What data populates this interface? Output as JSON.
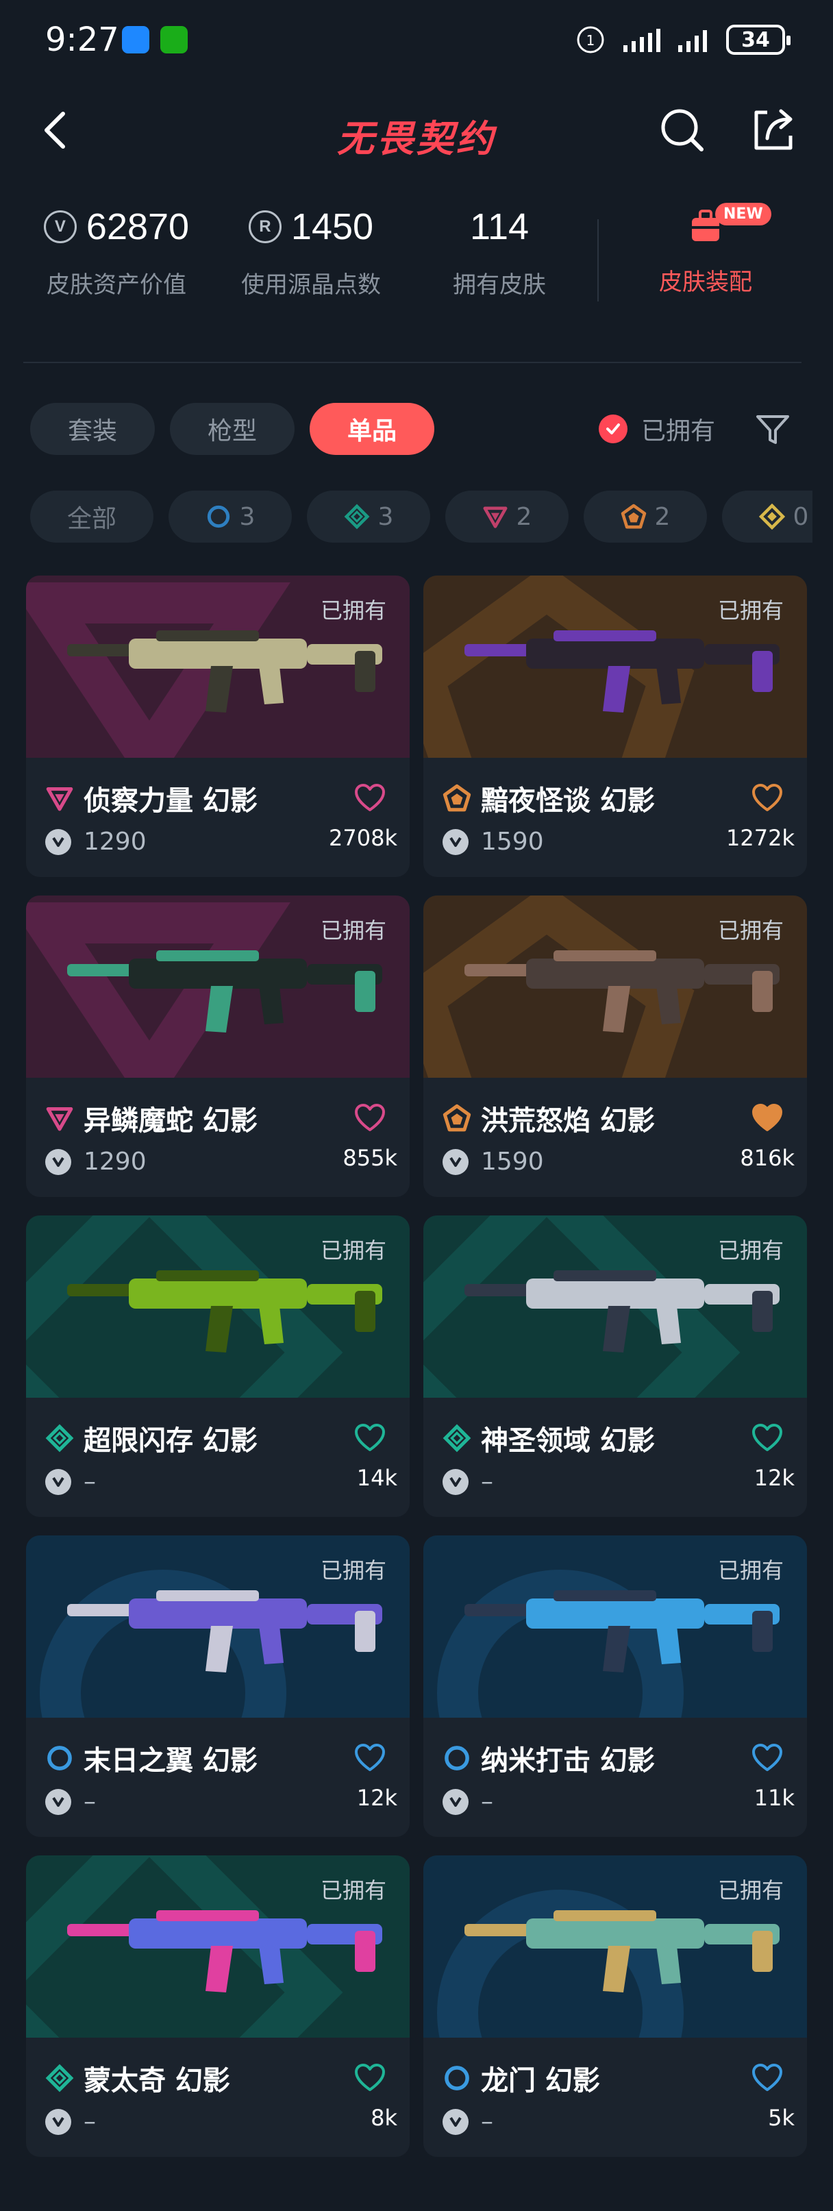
{
  "status_bar": {
    "time": "9:27",
    "network_label": "1",
    "battery": "34"
  },
  "header": {
    "title": "无畏契约"
  },
  "stats": {
    "asset_value": "62870",
    "asset_label": "皮肤资产价值",
    "radianite": "1450",
    "radianite_label": "使用源晶点数",
    "skins": "114",
    "skins_label": "拥有皮肤",
    "equip_label": "皮肤装配",
    "equip_badge": "NEW"
  },
  "tabs": [
    {
      "label": "套装",
      "active": false
    },
    {
      "label": "枪型",
      "active": false
    },
    {
      "label": "单品",
      "active": true
    }
  ],
  "owned_filter": {
    "label": "已拥有",
    "checked": true
  },
  "rarity_chips": [
    {
      "label": "全部",
      "icon": "",
      "color": ""
    },
    {
      "label": "3",
      "icon": "select-tier-icon",
      "color": "#2e7fc0"
    },
    {
      "label": "3",
      "icon": "deluxe-tier-icon",
      "color": "#1a9a84"
    },
    {
      "label": "2",
      "icon": "premium-tier-icon",
      "color": "#c0406a"
    },
    {
      "label": "2",
      "icon": "exclusive-tier-icon",
      "color": "#d9803a"
    },
    {
      "label": "0",
      "icon": "ultra-tier-icon",
      "color": "#d8b84a"
    }
  ],
  "cards": [
    {
      "name": "侦察力量 幻影",
      "price": "1290",
      "likes": "2708k",
      "owned": "已拥有",
      "tier": "premium",
      "tier_color": "#d84a8a",
      "bg": "#3a1d33",
      "bg_accent": "#5a2448",
      "liked": false,
      "gun_color": "#b9b48c",
      "gun_accent": "#3a3a30"
    },
    {
      "name": "黯夜怪谈 幻影",
      "price": "1590",
      "likes": "1272k",
      "owned": "已拥有",
      "tier": "exclusive",
      "tier_color": "#e08a40",
      "bg": "#3a2a1c",
      "bg_accent": "#5a3d20",
      "liked": false,
      "gun_color": "#2a2430",
      "gun_accent": "#6a3ab0"
    },
    {
      "name": "异鳞魔蛇 幻影",
      "price": "1290",
      "likes": "855k",
      "owned": "已拥有",
      "tier": "premium",
      "tier_color": "#d84a8a",
      "bg": "#3a1d33",
      "bg_accent": "#5a2448",
      "liked": false,
      "gun_color": "#1e2a28",
      "gun_accent": "#3aa080"
    },
    {
      "name": "洪荒怒焰 幻影",
      "price": "1590",
      "likes": "816k",
      "owned": "已拥有",
      "tier": "exclusive",
      "tier_color": "#e08a40",
      "bg": "#3a2a1c",
      "bg_accent": "#5a3d20",
      "liked": true,
      "gun_color": "#4a3e3a",
      "gun_accent": "#8a6a5a"
    },
    {
      "name": "超限闪存 幻影",
      "price": "–",
      "likes": "14k",
      "owned": "已拥有",
      "tier": "deluxe",
      "tier_color": "#1fb597",
      "bg": "#0f3a38",
      "bg_accent": "#12504b",
      "liked": false,
      "gun_color": "#7ab51f",
      "gun_accent": "#3a5a10"
    },
    {
      "name": "神圣领域 幻影",
      "price": "–",
      "likes": "12k",
      "owned": "已拥有",
      "tier": "deluxe",
      "tier_color": "#1fb597",
      "bg": "#0f3a38",
      "bg_accent": "#12504b",
      "liked": false,
      "gun_color": "#c0c6d0",
      "gun_accent": "#303848"
    },
    {
      "name": "末日之翼 幻影",
      "price": "–",
      "likes": "12k",
      "owned": "已拥有",
      "tier": "select",
      "tier_color": "#3a9ae0",
      "bg": "#0f2e45",
      "bg_accent": "#154060",
      "liked": false,
      "gun_color": "#6a5ad0",
      "gun_accent": "#c8c8d8"
    },
    {
      "name": "纳米打击 幻影",
      "price": "–",
      "likes": "11k",
      "owned": "已拥有",
      "tier": "select",
      "tier_color": "#3a9ae0",
      "bg": "#0f2e45",
      "bg_accent": "#154060",
      "liked": false,
      "gun_color": "#3aa0e0",
      "gun_accent": "#2a3850"
    },
    {
      "name": "蒙太奇 幻影",
      "price": "–",
      "likes": "8k",
      "owned": "已拥有",
      "tier": "deluxe",
      "tier_color": "#1fb597",
      "bg": "#0f3a38",
      "bg_accent": "#12504b",
      "liked": false,
      "gun_color": "#5a6ae0",
      "gun_accent": "#e040a0"
    },
    {
      "name": "龙门 幻影",
      "price": "–",
      "likes": "5k",
      "owned": "已拥有",
      "tier": "select",
      "tier_color": "#3a9ae0",
      "bg": "#0f2e45",
      "bg_accent": "#154060",
      "liked": false,
      "gun_color": "#6ab0a0",
      "gun_accent": "#c8a860"
    }
  ]
}
